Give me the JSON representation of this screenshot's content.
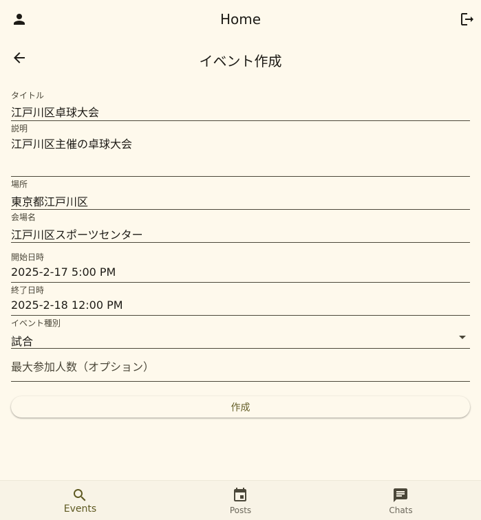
{
  "app_bar": {
    "title": "Home",
    "profile_icon": "person-icon",
    "logout_icon": "logout-icon"
  },
  "page": {
    "title": "イベント作成",
    "back_icon": "arrow-back-icon"
  },
  "form": {
    "title_field": {
      "label": "タイトル",
      "value": "江戸川区卓球大会"
    },
    "description_field": {
      "label": "説明",
      "value": "江戸川区主催の卓球大会"
    },
    "location_field": {
      "label": "場所",
      "value": "東京都江戸川区"
    },
    "venue_field": {
      "label": "会場名",
      "value": "江戸川区スポーツセンター"
    },
    "start_field": {
      "label": "開始日時",
      "value": "2025-2-17 5:00 PM"
    },
    "end_field": {
      "label": "終了日時",
      "value": "2025-2-18 12:00 PM"
    },
    "type_field": {
      "label": "イベント種別",
      "value": "試合"
    },
    "max_field": {
      "placeholder": "最大参加人数（オプション）"
    },
    "submit_label": "作成"
  },
  "bottom_nav": {
    "items": [
      {
        "label": "Events",
        "icon": "search-icon",
        "active": true
      },
      {
        "label": "Posts",
        "icon": "calendar-icon",
        "active": false
      },
      {
        "label": "Chats",
        "icon": "chat-icon",
        "active": false
      }
    ]
  },
  "colors": {
    "background": "#fef9ec",
    "accent": "#66602a",
    "nav_background": "#f8f3e6"
  }
}
